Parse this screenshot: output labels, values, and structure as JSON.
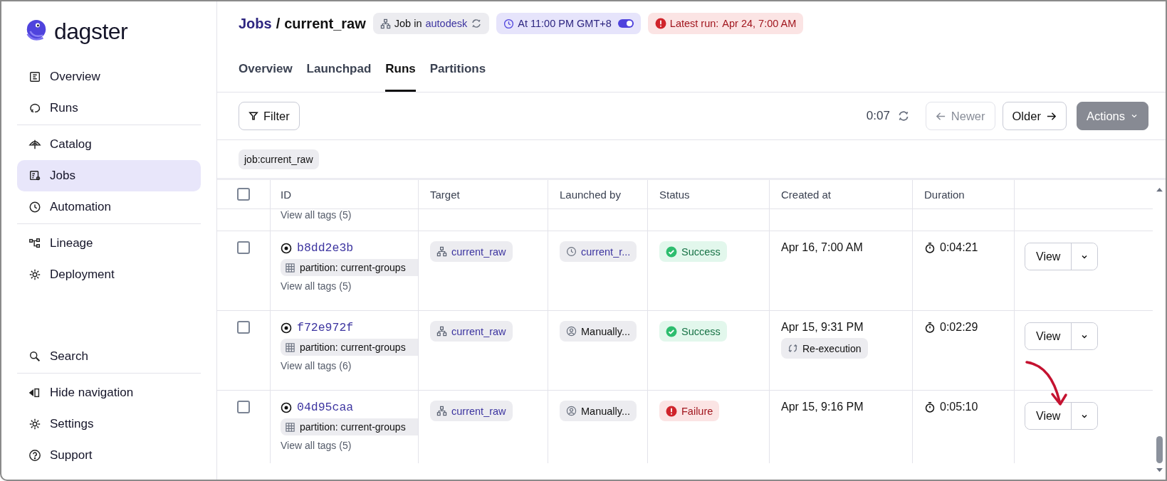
{
  "brand": "dagster",
  "sidebar": {
    "top_groups": [
      [
        {
          "label": "Overview",
          "selected": false
        },
        {
          "label": "Runs",
          "selected": false
        }
      ],
      [
        {
          "label": "Catalog",
          "selected": false
        },
        {
          "label": "Jobs",
          "selected": true
        },
        {
          "label": "Automation",
          "selected": false
        }
      ],
      [
        {
          "label": "Lineage",
          "selected": false
        },
        {
          "label": "Deployment",
          "selected": false
        }
      ]
    ],
    "bottom_groups": [
      [
        {
          "label": "Search",
          "selected": false
        }
      ],
      [
        {
          "label": "Hide navigation",
          "selected": false
        },
        {
          "label": "Settings",
          "selected": false
        },
        {
          "label": "Support",
          "selected": false
        }
      ]
    ]
  },
  "breadcrumb": {
    "parent": "Jobs",
    "separator": "/",
    "current": "current_raw"
  },
  "job_badge": {
    "prefix": "Job in",
    "location": "autodesk"
  },
  "schedule_badge": {
    "label": "At 11:00 PM GMT+8",
    "on": true
  },
  "latest_run_badge": {
    "label": "Latest run:",
    "time": "Apr 24, 7:00 AM",
    "kind": "failure"
  },
  "tabs": [
    {
      "label": "Overview",
      "selected": false
    },
    {
      "label": "Launchpad",
      "selected": false
    },
    {
      "label": "Runs",
      "selected": true
    },
    {
      "label": "Partitions",
      "selected": false
    }
  ],
  "toolbar": {
    "filter": "Filter",
    "refresh_timer": "0:07",
    "newer": {
      "label": "Newer",
      "disabled": true
    },
    "older": {
      "label": "Older",
      "disabled": false
    },
    "actions": "Actions"
  },
  "filter_tags": [
    "job:current_raw"
  ],
  "table": {
    "header_checked": false,
    "columns": [
      "ID",
      "Target",
      "Launched by",
      "Status",
      "Created at",
      "Duration"
    ],
    "partial_row": {
      "tags_link": "View all tags (5)"
    },
    "rows": [
      {
        "checked": false,
        "id": "b8dd2e3b",
        "tag": "partition: current-groups",
        "tags_link": "View all tags (5)",
        "target": "current_raw",
        "launched_by": {
          "kind": "schedule",
          "text": "current_r..."
        },
        "status": {
          "kind": "success",
          "text": "Success"
        },
        "created": "Apr 16, 7:00 AM",
        "duration": "0:04:21",
        "view": "View"
      },
      {
        "checked": false,
        "id": "f72e972f",
        "tag": "partition: current-groups",
        "tags_link": "View all tags (6)",
        "target": "current_raw",
        "launched_by": {
          "kind": "manual",
          "text": "Manually..."
        },
        "status": {
          "kind": "success",
          "text": "Success"
        },
        "created": "Apr 15, 9:31 PM",
        "created_tag": "Re-execution",
        "duration": "0:02:29",
        "view": "View"
      },
      {
        "checked": false,
        "id": "04d95caa",
        "tag": "partition: current-groups",
        "tags_link": "View all tags (5)",
        "target": "current_raw",
        "launched_by": {
          "kind": "manual",
          "text": "Manually..."
        },
        "status": {
          "kind": "failure",
          "text": "Failure"
        },
        "created": "Apr 15, 9:16 PM",
        "duration": "0:05:10",
        "view": "View"
      }
    ]
  }
}
